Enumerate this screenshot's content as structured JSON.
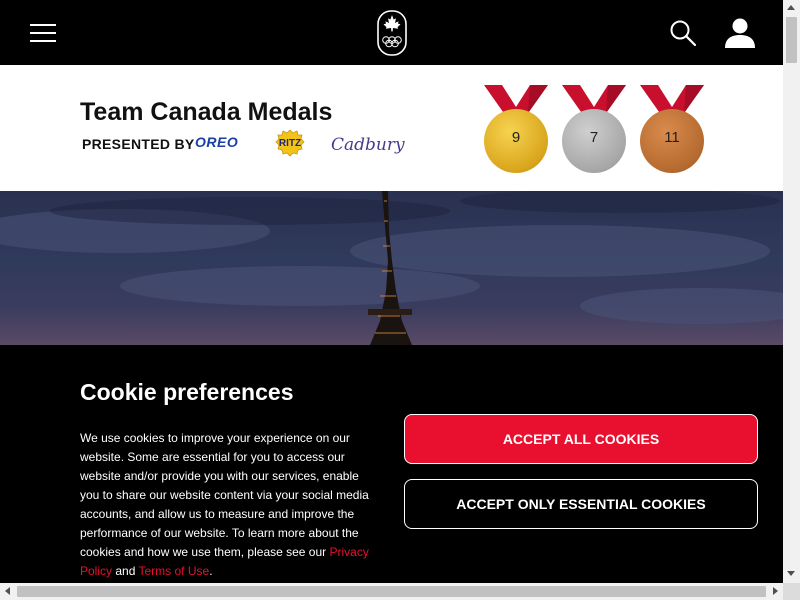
{
  "header": {
    "menu_icon": "hamburger-menu-icon",
    "logo_icon": "canada-olympic-logo",
    "search_icon": "search-icon",
    "account_icon": "user-icon"
  },
  "medals": {
    "title": "Team Canada Medals",
    "presented_by": "PRESENTED BY",
    "sponsors": [
      "OREO",
      "RITZ",
      "Cadbury"
    ],
    "gold": "9",
    "silver": "7",
    "bronze": "11"
  },
  "cookie": {
    "title": "Cookie preferences",
    "body": "We use cookies to improve your experience on our website. Some are essential for you to access our website and/or provide you with our services, enable you to share our website content via your social media accounts, and allow us to measure and improve the performance of our website. To learn more about the cookies and how we use them, please see our ",
    "privacy_link": "Privacy Policy",
    "conjunction": " and ",
    "terms_link": "Terms of Use",
    "end": ".",
    "accept_all": "ACCEPT ALL COOKIES",
    "accept_essential": "ACCEPT ONLY ESSENTIAL COOKIES"
  },
  "colors": {
    "header_bg": "#000000",
    "accent_red": "#e8102e",
    "ribbon_red": "#c8102e"
  }
}
